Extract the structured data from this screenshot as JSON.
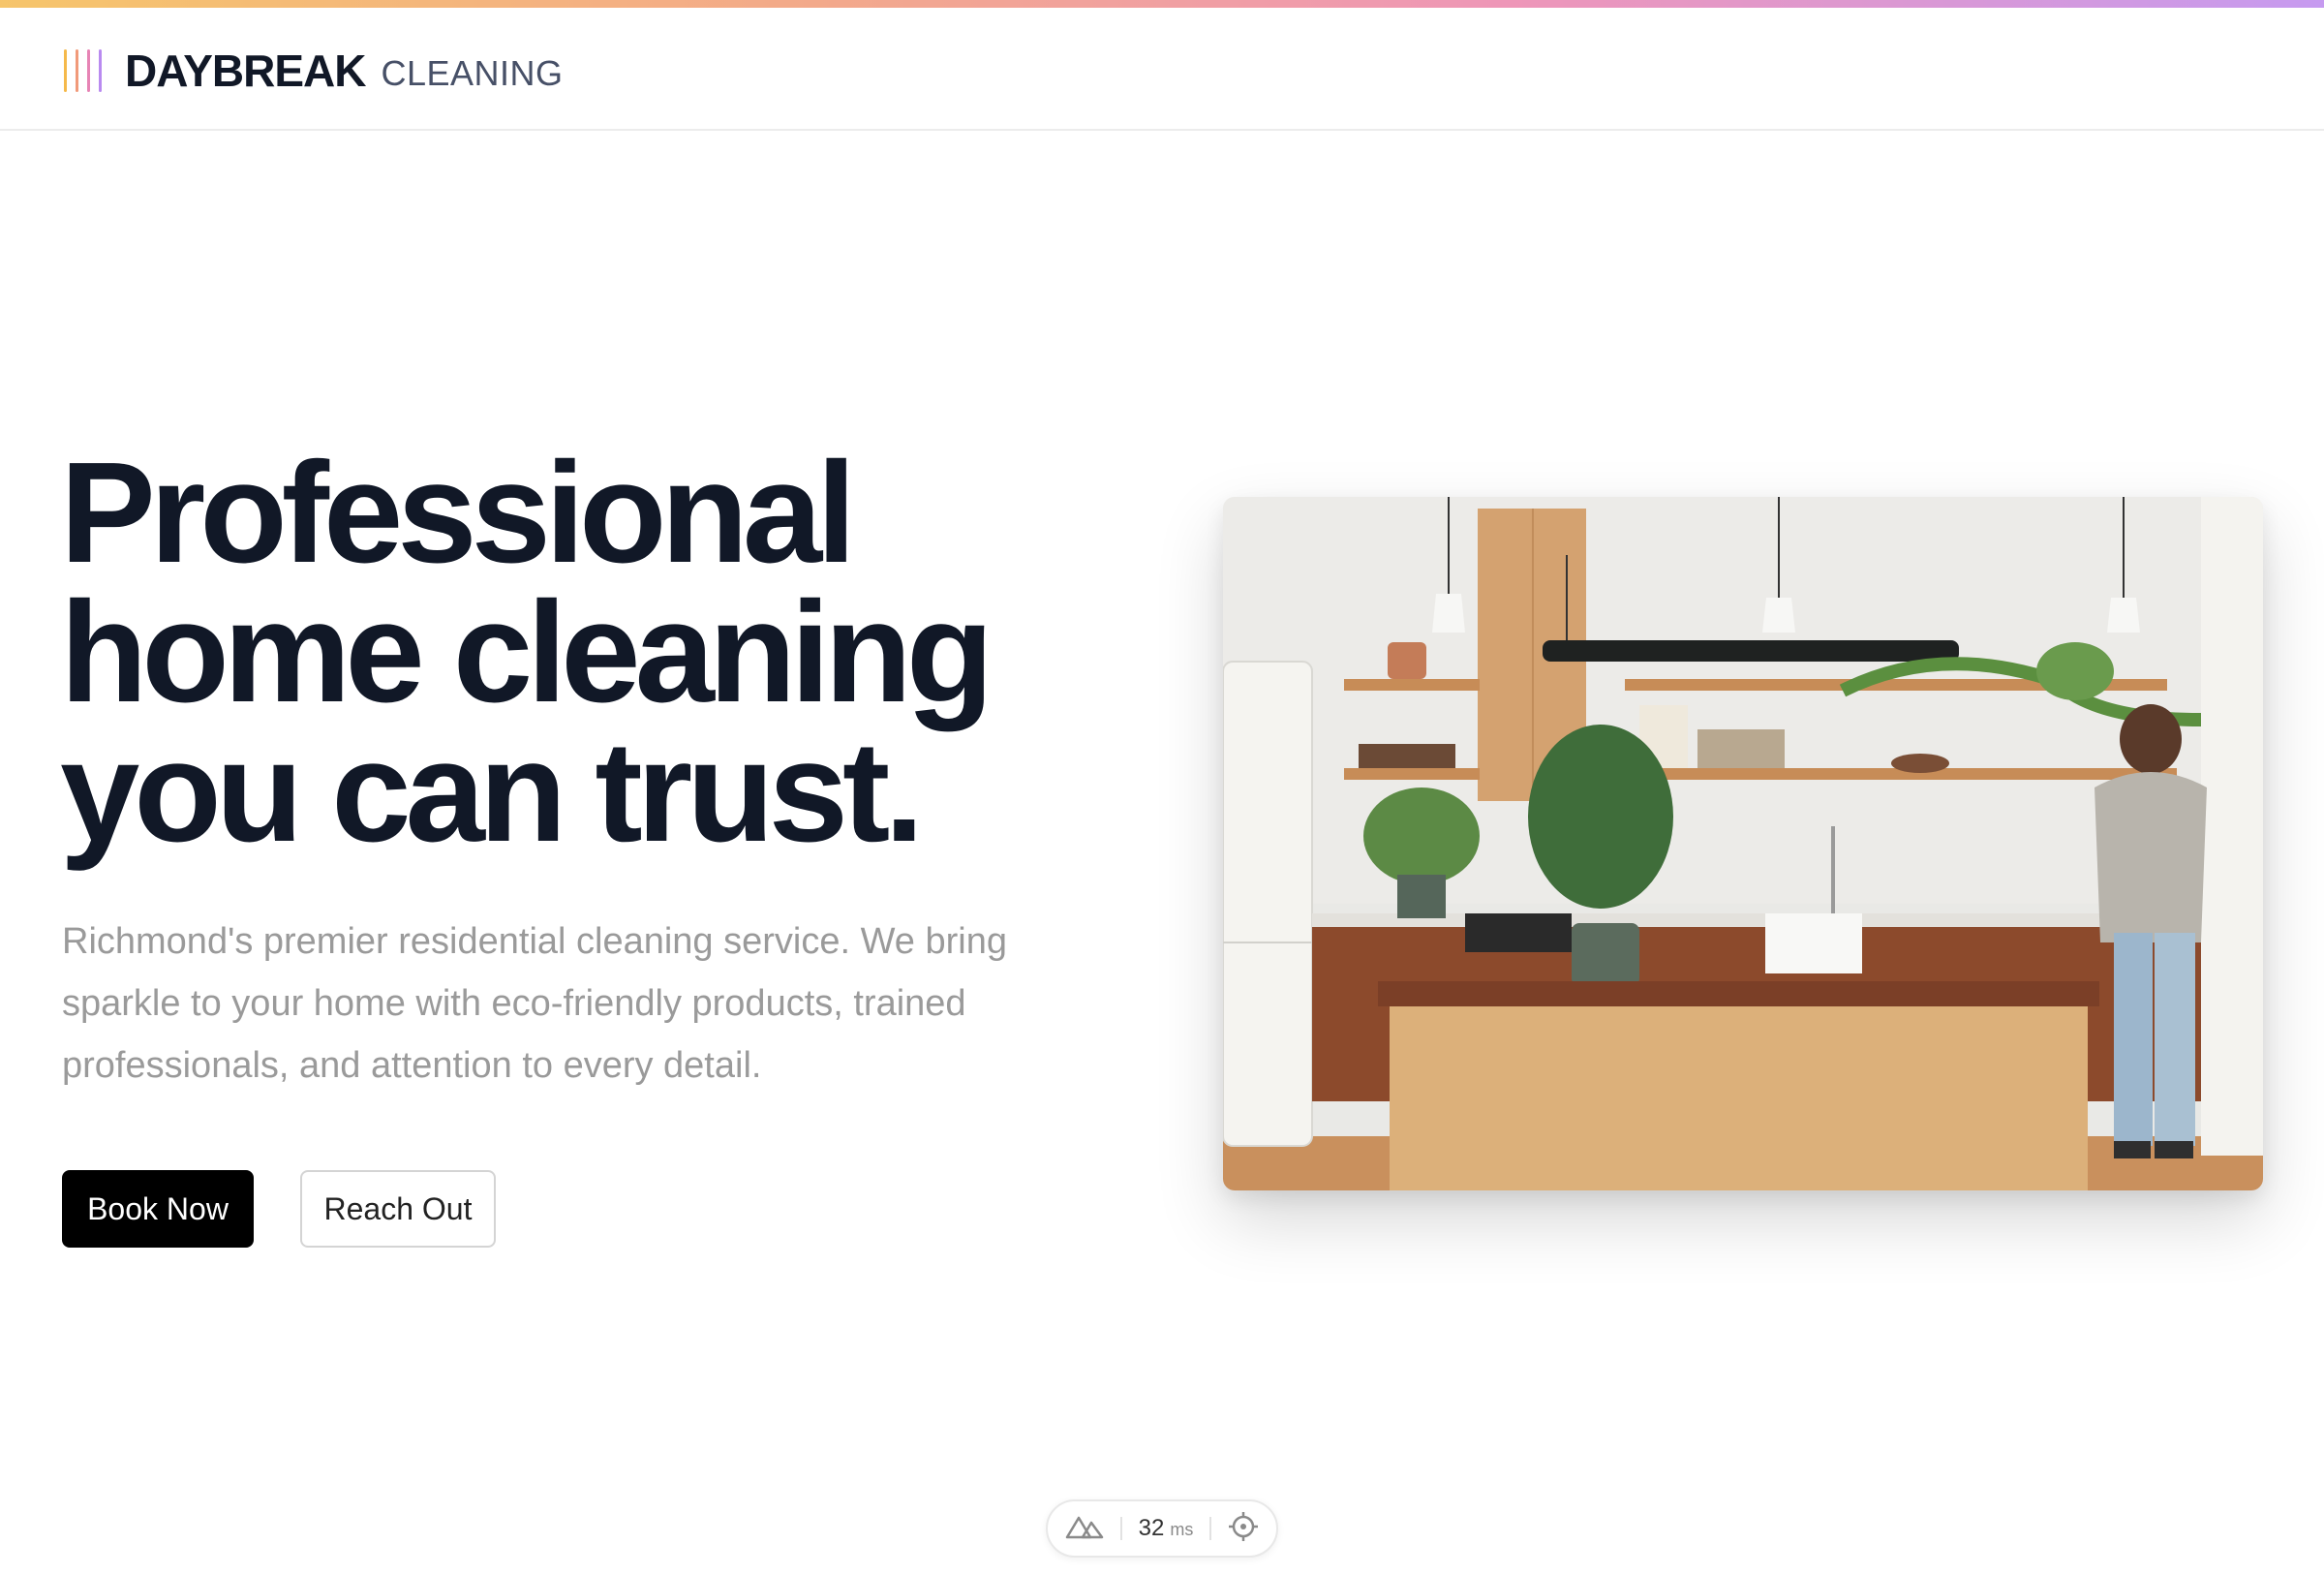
{
  "colors": {
    "accent_gradient": [
      "#f6c56b",
      "#f3a98a",
      "#ee96b8",
      "#c69af0"
    ],
    "logo_bars": [
      "#f5b94a",
      "#f19a7a",
      "#e784b5",
      "#b98af0"
    ],
    "heading": "#111827",
    "body_text": "#9a9a9a",
    "primary_button_bg": "#000000"
  },
  "header": {
    "brand_main": "DAYBREAK",
    "brand_sub": "CLEANING"
  },
  "hero": {
    "title_lines": [
      "Professional",
      "home cleaning",
      "you can trust."
    ],
    "description": "Richmond's premier residential cleaning service. We bring sparkle to your home with eco-friendly products, trained professionals, and attention to every detail.",
    "primary_cta": "Book Now",
    "secondary_cta": "Reach Out",
    "image": {
      "icon": "kitchen-photo"
    }
  },
  "devbar": {
    "logo_icon": "nuxt-icon",
    "value": "32",
    "unit": "ms",
    "action_icon": "crosshair-icon"
  }
}
